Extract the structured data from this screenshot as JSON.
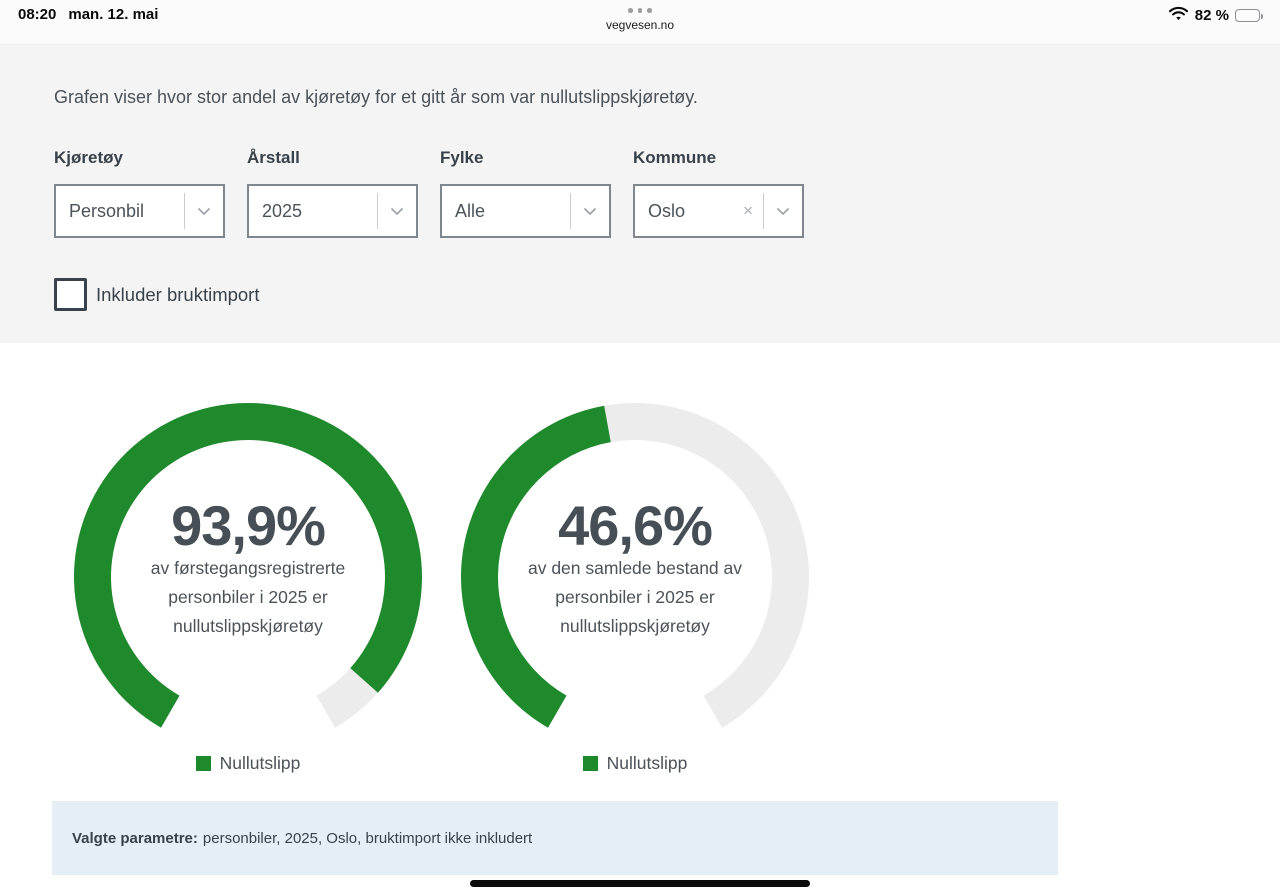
{
  "status_bar": {
    "time": "08:20",
    "date": "man. 12. mai",
    "site": "vegvesen.no",
    "battery": "82 %",
    "battery_level": 0.82
  },
  "filters": {
    "description": "Grafen viser hvor stor andel av kjøretøy for et gitt år som var nullutslippskjøretøy.",
    "fields": [
      {
        "label": "Kjøretøy",
        "value": "Personbil"
      },
      {
        "label": "Årstall",
        "value": "2025"
      },
      {
        "label": "Fylke",
        "value": "Alle"
      },
      {
        "label": "Kommune",
        "value": "Oslo"
      }
    ],
    "checkbox": {
      "label": "Inkluder bruktimport",
      "checked": false
    }
  },
  "chart_data": [
    {
      "type": "gauge",
      "value": 93.9,
      "min": 0,
      "max": 100,
      "start_angle": -150,
      "end_angle": 150,
      "value_label": "93,9%",
      "description_lines": [
        "av førstegangsregistrerte",
        "personbiler i 2025 er",
        "nullutslippskjøretøy"
      ],
      "legend": "Nullutslipp",
      "color": "#1f8a2c",
      "track_color": "#ececec"
    },
    {
      "type": "gauge",
      "value": 46.6,
      "min": 0,
      "max": 100,
      "start_angle": -150,
      "end_angle": 150,
      "value_label": "46,6%",
      "description_lines": [
        "av den samlede bestand av",
        "personbiler i 2025 er",
        "nullutslippskjøretøy"
      ],
      "legend": "Nullutslipp",
      "color": "#1f8a2c",
      "track_color": "#ececec"
    }
  ],
  "summary": {
    "label": "Valgte parametre:",
    "text": "personbiler, 2025, Oslo, bruktimport ikke inkludert"
  },
  "colors": {
    "accent_green": "#1f8a2c",
    "track_gray": "#ececec",
    "filter_band_bg": "#f4f4f4",
    "summary_bg": "#e4eef4",
    "text_dark": "#39424a"
  }
}
